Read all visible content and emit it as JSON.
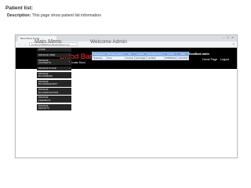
{
  "doc": {
    "heading": "Patient list:",
    "description_label": "Description:",
    "description_text": " This page show  patient list information"
  },
  "browser": {
    "tab_title": "Blood Bank Portal",
    "window_controls": "– ☐ ✕",
    "nav_icons": "← → ⟳",
    "url": "localhost:8080/bloodbank/patient.jsp",
    "menu_icon": "≡"
  },
  "header": {
    "title": "Blood Bank Portal",
    "subtitle": "Please Donate Blood",
    "admin_label": "BloodBank admin",
    "home_link": "Home Page",
    "logout_link": "Logout"
  },
  "sidebar": {
    "title": "Main Menu",
    "items": [
      {
        "label": "HOME",
        "arrow": ""
      },
      {
        "label": "MANAGE USER",
        "arrow": "›"
      },
      {
        "label": "MANAGE\nCONTENTS",
        "arrow": "›"
      },
      {
        "label": "MANAGE PLACE",
        "arrow": "›"
      },
      {
        "label": "MANAGE\nBLOODBANK",
        "arrow": ""
      },
      {
        "label": "MANAGE\nBLOODREQUEST",
        "arrow": ""
      },
      {
        "label": "MANAGE\nBLOODDONATION",
        "arrow": ""
      },
      {
        "label": "MANAGE\nFEEDBACK",
        "arrow": ""
      },
      {
        "label": "MANAGE\nREPORTS",
        "arrow": ""
      }
    ]
  },
  "main": {
    "welcome": "Welcome Admin",
    "table": {
      "columns": [
        "PatientName",
        "BloodGroupName",
        "City",
        "Location",
        "BloodBankName",
        "Contact",
        "Date"
      ],
      "rows": [
        [
          "Sivaraman",
          "B+ve",
          "Chennai",
          "Anna Nagar",
          "Life Bank",
          "9876543210",
          "12/07/2016"
        ]
      ]
    }
  }
}
